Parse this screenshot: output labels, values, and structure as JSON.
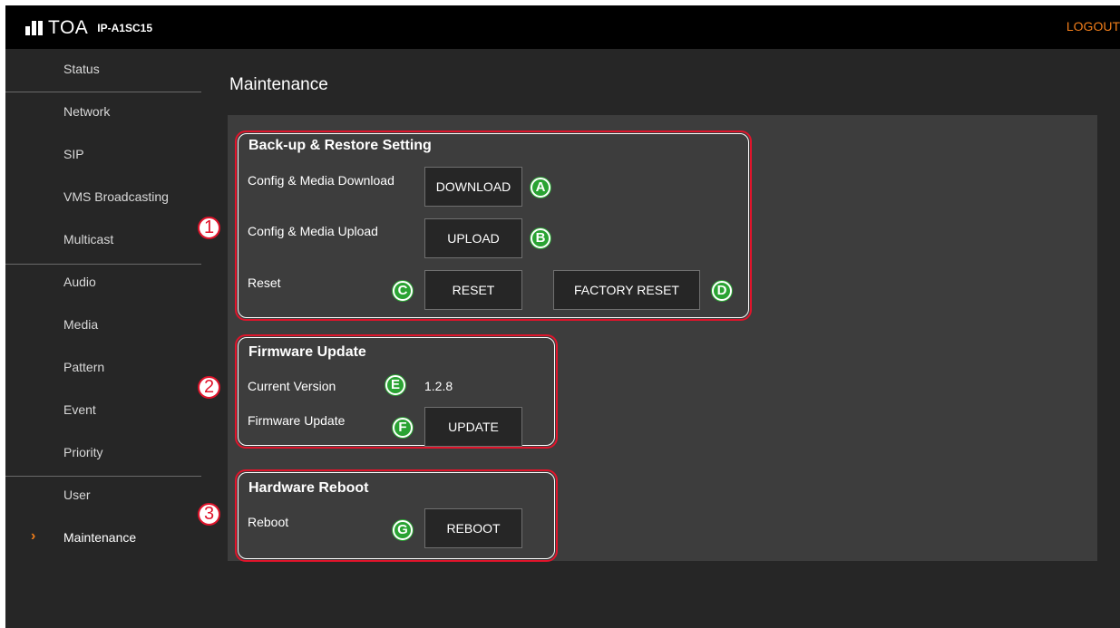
{
  "header": {
    "brand": "TOA",
    "model": "IP-A1SC15",
    "logout_label": "LOGOUT",
    "accent_color": "#f07d1a"
  },
  "sidebar": {
    "items": [
      {
        "label": "Status"
      },
      {
        "label": "Network"
      },
      {
        "label": "SIP"
      },
      {
        "label": "VMS Broadcasting"
      },
      {
        "label": "Multicast"
      },
      {
        "label": "Audio"
      },
      {
        "label": "Media"
      },
      {
        "label": "Pattern"
      },
      {
        "label": "Event"
      },
      {
        "label": "Priority"
      },
      {
        "label": "User"
      },
      {
        "label": "Maintenance",
        "active": true
      }
    ],
    "active_icon": "chevron-right-icon"
  },
  "main": {
    "title": "Maintenance",
    "backup": {
      "title": "Back-up & Restore Setting",
      "download_label": "Config & Media Download",
      "download_button": "DOWNLOAD",
      "upload_label": "Config & Media Upload",
      "upload_button": "UPLOAD",
      "reset_label": "Reset",
      "reset_button": "RESET",
      "factory_reset_button": "FACTORY RESET"
    },
    "firmware": {
      "title": "Firmware Update",
      "version_label": "Current Version",
      "version_value": "1.2.8",
      "update_label": "Firmware Update",
      "update_button": "UPDATE"
    },
    "reboot": {
      "title": "Hardware Reboot",
      "reboot_label": "Reboot",
      "reboot_button": "REBOOT"
    }
  },
  "callouts": {
    "numbers": [
      "1",
      "2",
      "3"
    ],
    "letters": [
      "A",
      "B",
      "C",
      "D",
      "E",
      "F",
      "G"
    ],
    "box_color": "#e0142b",
    "letter_color": "#2aa333"
  }
}
